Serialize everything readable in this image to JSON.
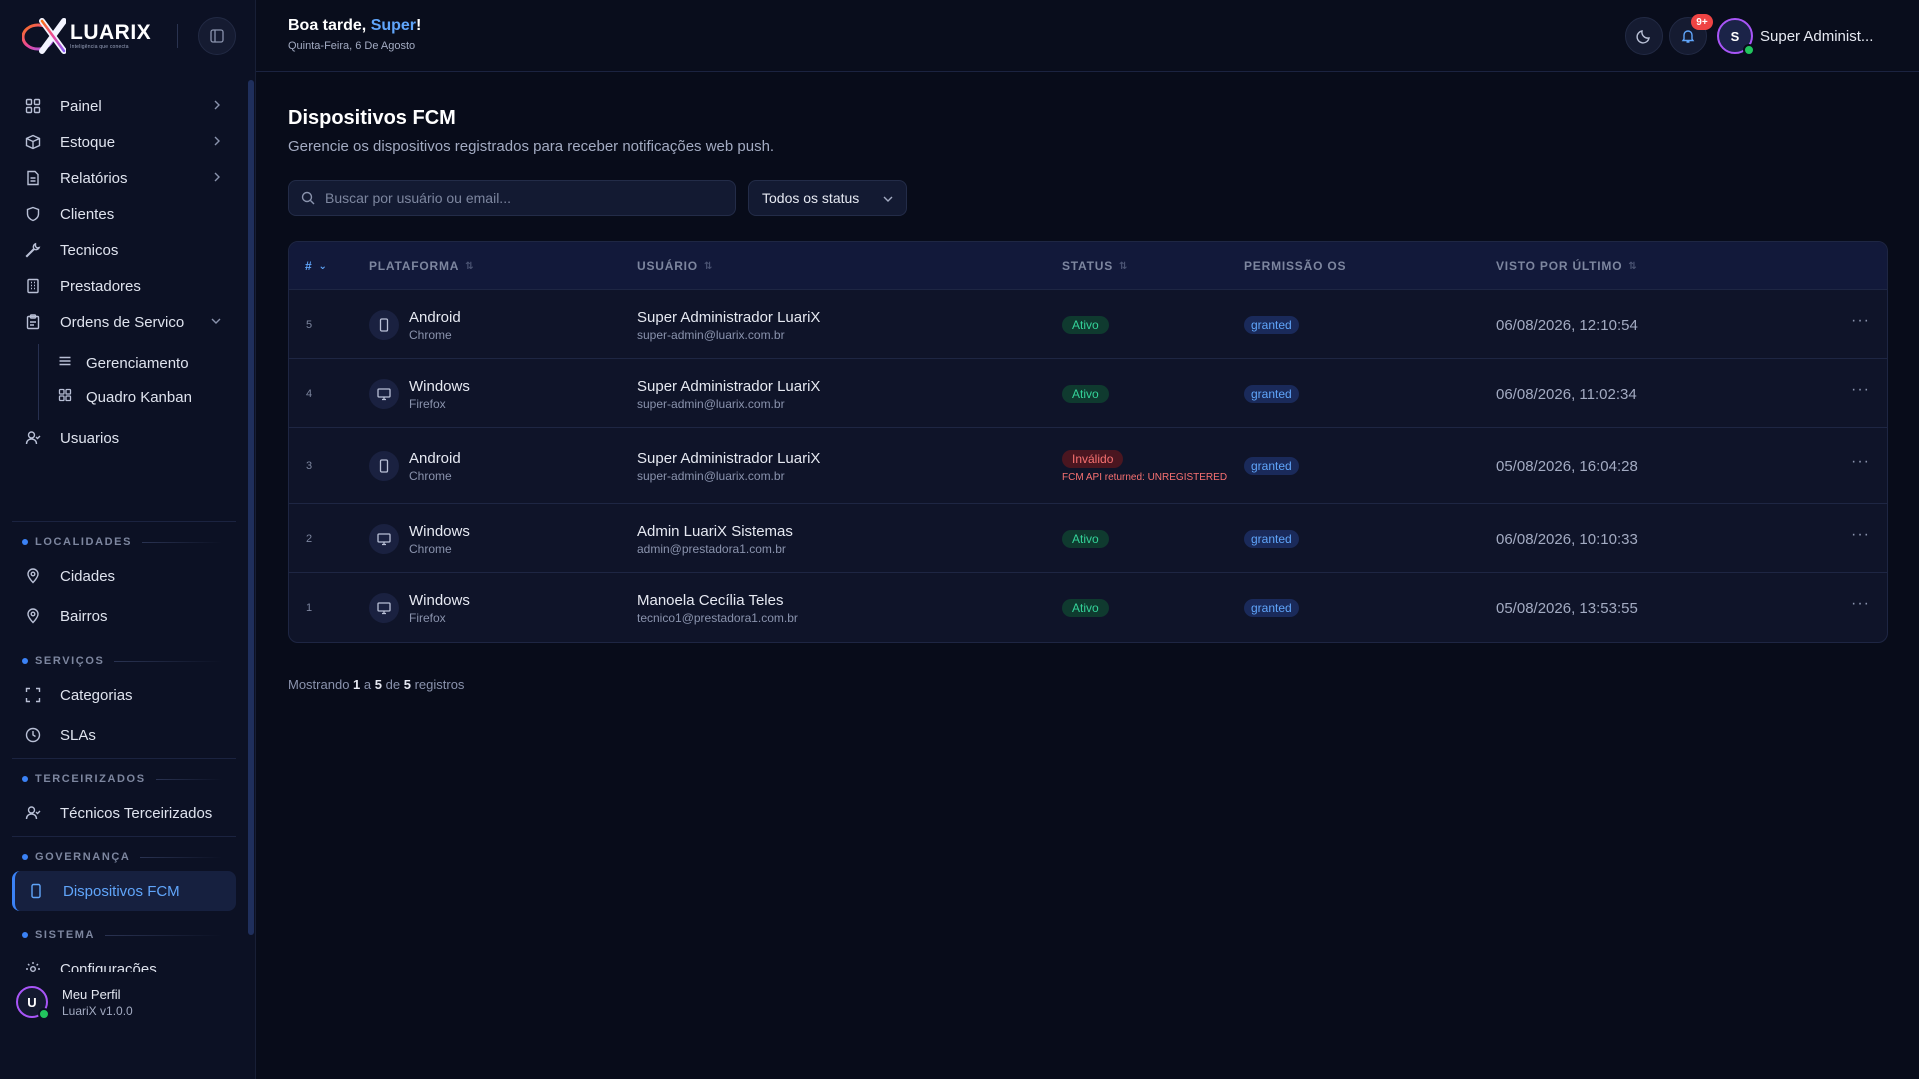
{
  "brand": {
    "name": "LUARIX",
    "tagline": "Inteligência que conecta"
  },
  "sidebar": {
    "items": [
      {
        "label": "Painel",
        "icon": "dashboard-icon"
      },
      {
        "label": "Estoque",
        "icon": "box-icon"
      },
      {
        "label": "Relatórios",
        "icon": "document-icon"
      },
      {
        "label": "Clientes",
        "icon": "shield-icon"
      },
      {
        "label": "Tecnicos",
        "icon": "wrench-icon"
      },
      {
        "label": "Prestadores",
        "icon": "building-icon"
      },
      {
        "label": "Ordens de Servico",
        "icon": "clipboard-icon"
      },
      {
        "label": "Usuarios",
        "icon": "user-icon"
      }
    ],
    "sub_items": [
      {
        "label": "Gerenciamento",
        "icon": "list-icon"
      },
      {
        "label": "Quadro Kanban",
        "icon": "grid-icon"
      }
    ],
    "sections": {
      "localidades": {
        "title": "LOCALIDADES",
        "items": [
          "Cidades",
          "Bairros"
        ]
      },
      "servicos": {
        "title": "SERVIÇOS",
        "items": [
          "Categorias",
          "SLAs"
        ]
      },
      "terceirizados": {
        "title": "TERCEIRIZADOS",
        "items": [
          "Técnicos Terceirizados"
        ]
      },
      "governanca": {
        "title": "GOVERNANÇA",
        "items": [
          "Dispositivos FCM"
        ]
      },
      "sistema": {
        "title": "SISTEMA",
        "items": [
          "Configurações"
        ]
      }
    },
    "profile": {
      "initial": "U",
      "name": "Meu Perfil",
      "version": "LuariX v1.0.0"
    }
  },
  "header": {
    "greeting_prefix": "Boa tarde, ",
    "greeting_name": "Super",
    "greeting_suffix": "!",
    "date": "Quinta-Feira, 6 De Agosto",
    "notifications_badge": "9+",
    "user_initial": "S",
    "user_name": "Super Administ..."
  },
  "main": {
    "title": "Dispositivos FCM",
    "subtitle": "Gerencie os dispositivos registrados para receber notificações web push.",
    "search_placeholder": "Buscar por usuário ou email...",
    "status_filter": "Todos os status",
    "columns": [
      "#",
      "PLATAFORMA",
      "USUÁRIO",
      "STATUS",
      "PERMISSÃO OS",
      "VISTO POR ÚLTIMO"
    ],
    "rows": [
      {
        "id": "5",
        "platform": "Android",
        "browser": "Chrome",
        "device": "phone-icon",
        "user": "Super Administrador LuariX",
        "email": "super-admin@luarix.com.br",
        "status": "Ativo",
        "status_kind": "ok",
        "error": "",
        "permission": "granted",
        "last_seen": "06/08/2026, 12:10:54"
      },
      {
        "id": "4",
        "platform": "Windows",
        "browser": "Firefox",
        "device": "monitor-icon",
        "user": "Super Administrador LuariX",
        "email": "super-admin@luarix.com.br",
        "status": "Ativo",
        "status_kind": "ok",
        "error": "",
        "permission": "granted",
        "last_seen": "06/08/2026, 11:02:34"
      },
      {
        "id": "3",
        "platform": "Android",
        "browser": "Chrome",
        "device": "phone-icon",
        "user": "Super Administrador LuariX",
        "email": "super-admin@luarix.com.br",
        "status": "Inválido",
        "status_kind": "bad",
        "error": "FCM API returned: UNREGISTERED",
        "permission": "granted",
        "last_seen": "05/08/2026, 16:04:28"
      },
      {
        "id": "2",
        "platform": "Windows",
        "browser": "Chrome",
        "device": "monitor-icon",
        "user": "Admin LuariX Sistemas",
        "email": "admin@prestadora1.com.br",
        "status": "Ativo",
        "status_kind": "ok",
        "error": "",
        "permission": "granted",
        "last_seen": "06/08/2026, 10:10:33"
      },
      {
        "id": "1",
        "platform": "Windows",
        "browser": "Firefox",
        "device": "monitor-icon",
        "user": "Manoela Cecília Teles",
        "email": "tecnico1@prestadora1.com.br",
        "status": "Ativo",
        "status_kind": "ok",
        "error": "",
        "permission": "granted",
        "last_seen": "05/08/2026, 13:53:55"
      }
    ],
    "footer": {
      "prefix": "Mostrando",
      "from": "1",
      "a": "a",
      "to": "5",
      "de": "de",
      "total": "5",
      "suffix": "registros"
    }
  },
  "colors": {
    "accent": "#3b82f6",
    "active": "#34d399",
    "invalid": "#f87171",
    "badge": "#ef4444",
    "avatar_ring": "#a855f7"
  }
}
